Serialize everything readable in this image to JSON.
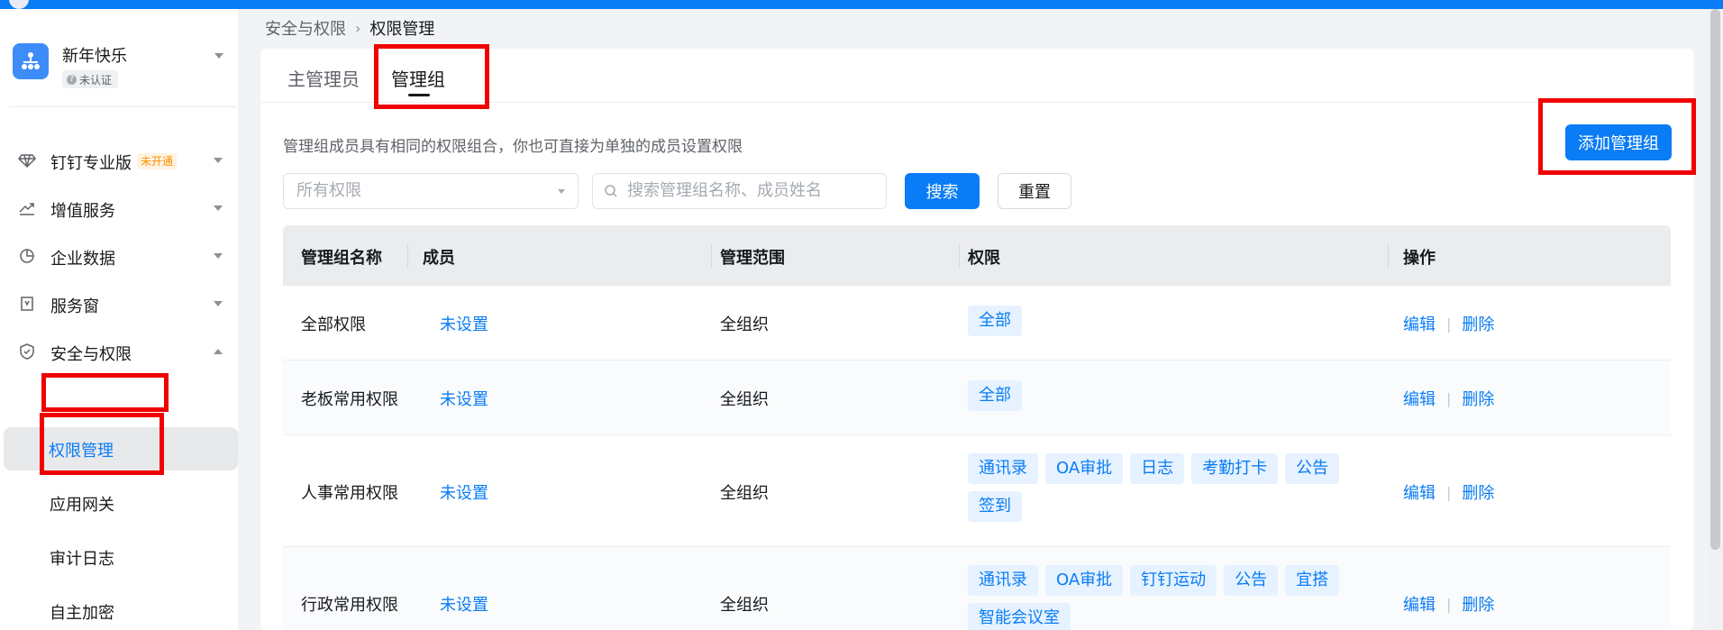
{
  "org": {
    "name": "新年快乐",
    "badge": "未认证"
  },
  "sidebar": {
    "items": [
      {
        "label": "钉钉专业版",
        "tag": "未开通",
        "icon": "diamond-icon"
      },
      {
        "label": "增值服务",
        "icon": "trend-icon"
      },
      {
        "label": "企业数据",
        "icon": "pie-chart-icon"
      },
      {
        "label": "服务窗",
        "icon": "bookmark-icon"
      },
      {
        "label": "安全与权限",
        "icon": "shield-icon"
      }
    ],
    "subitems": [
      {
        "label": "权限管理",
        "active": true
      },
      {
        "label": "应用网关"
      },
      {
        "label": "审计日志"
      },
      {
        "label": "自主加密"
      }
    ]
  },
  "breadcrumb": {
    "parent": "安全与权限",
    "current": "权限管理"
  },
  "tabs": [
    {
      "label": "主管理员"
    },
    {
      "label": "管理组"
    }
  ],
  "description": "管理组成员具有相同的权限组合，你也可直接为单独的成员设置权限",
  "buttons": {
    "add": "添加管理组",
    "search": "搜索",
    "reset": "重置"
  },
  "filters": {
    "permission_placeholder": "所有权限",
    "search_placeholder": "搜索管理组名称、成员姓名"
  },
  "table": {
    "headers": [
      "管理组名称",
      "成员",
      "管理范围",
      "权限",
      "操作"
    ],
    "rows": [
      {
        "name": "全部权限",
        "members": "未设置",
        "scope": "全组织",
        "permissions": [
          "全部"
        ],
        "edit": "编辑",
        "delete": "删除"
      },
      {
        "name": "老板常用权限",
        "members": "未设置",
        "scope": "全组织",
        "permissions": [
          "全部"
        ],
        "edit": "编辑",
        "delete": "删除"
      },
      {
        "name": "人事常用权限",
        "members": "未设置",
        "scope": "全组织",
        "permissions": [
          "通讯录",
          "OA审批",
          "日志",
          "考勤打卡",
          "公告",
          "签到"
        ],
        "edit": "编辑",
        "delete": "删除"
      },
      {
        "name": "行政常用权限",
        "members": "未设置",
        "scope": "全组织",
        "permissions": [
          "通讯录",
          "OA审批",
          "钉钉运动",
          "公告",
          "宜搭",
          "智能会议室"
        ],
        "edit": "编辑",
        "delete": "删除"
      }
    ]
  },
  "colors": {
    "accent": "#0a7cf5",
    "highlight": "#f00000",
    "tag_bg": "#e6f2ff"
  }
}
